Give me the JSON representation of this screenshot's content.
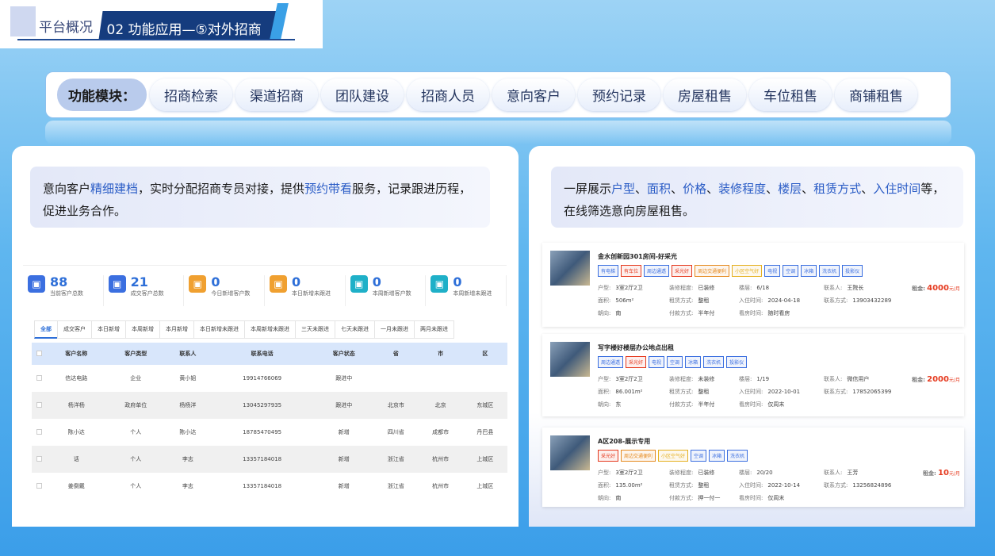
{
  "header": {
    "section": "平台概况",
    "title": "02 功能应用—⑤对外招商"
  },
  "modules": {
    "label": "功能模块：",
    "items": [
      "招商检索",
      "渠道招商",
      "团队建设",
      "招商人员",
      "意向客户",
      "预约记录",
      "房屋租售",
      "车位租售",
      "商铺租售"
    ]
  },
  "left": {
    "desc_a": "意向客户",
    "desc_b": "精细建档",
    "desc_c": "，实时分配招商专员对接，提供",
    "desc_d": "预约带看",
    "desc_e": "服务，记录跟进历程，促进业务合作。",
    "stats": [
      {
        "num": "88",
        "label": "当前客户总数",
        "color": "#3b6fe0"
      },
      {
        "num": "21",
        "label": "成交客户总数",
        "color": "#3b6fe0"
      },
      {
        "num": "0",
        "label": "今日新增客户数",
        "color": "#f0a030"
      },
      {
        "num": "0",
        "label": "本日新增未跟进",
        "color": "#f0a030"
      },
      {
        "num": "0",
        "label": "本周新增客户数",
        "color": "#1fb0c8"
      },
      {
        "num": "0",
        "label": "本周新增未跟进",
        "color": "#1fb0c8"
      }
    ],
    "tabs": [
      "全部",
      "成交客户",
      "本日新增",
      "本周新增",
      "本月新增",
      "本日新增未跟进",
      "本周新增未跟进",
      "三天未跟进",
      "七天未跟进",
      "一月未跟进",
      "两月未跟进"
    ],
    "columns": [
      "客户名称",
      "客户类型",
      "联系人",
      "联系电话",
      "客户状态",
      "省",
      "市",
      "区"
    ],
    "rows": [
      [
        "信达电路",
        "企业",
        "黄小姐",
        "19914766069",
        "跟进中",
        "",
        "",
        ""
      ],
      [
        "杨洋杨",
        "政府单位",
        "杨杨洋",
        "13045297935",
        "跟进中",
        "北京市",
        "北京",
        "东城区"
      ],
      [
        "陈小达",
        "个人",
        "陈小达",
        "18785470495",
        "新增",
        "四川省",
        "成都市",
        "丹巴县"
      ],
      [
        "话",
        "个人",
        "李志",
        "13357184018",
        "新增",
        "浙江省",
        "杭州市",
        "上城区"
      ],
      [
        "姜倒戴",
        "个人",
        "李志",
        "13357184018",
        "新增",
        "浙江省",
        "杭州市",
        "上城区"
      ]
    ]
  },
  "right": {
    "desc_a": "一屏展示",
    "desc_b": "户型",
    "desc_c": "、",
    "desc_d": "面积",
    "desc_e": "、",
    "desc_f": "价格",
    "desc_g": "、",
    "desc_h": "装修程度",
    "desc_i": "、",
    "desc_j": "楼层",
    "desc_k": "、",
    "desc_l": "租赁方式",
    "desc_m": "、",
    "desc_n": "入住时间",
    "desc_o": "等，在线筛选意向房屋租售。",
    "labels": {
      "type": "户型:",
      "area": "面积:",
      "dir": "朝向:",
      "deco": "装修程度:",
      "lease": "租赁方式:",
      "pay": "付款方式:",
      "floor": "楼层:",
      "move": "入住时间:",
      "view": "看房时间:",
      "contact": "联系人:",
      "phone": "联系方式:",
      "rent": "租金:",
      "unit": "元/月"
    },
    "cards": [
      {
        "title": "金水创新园301房间-好采光",
        "tags": [
          "有电梯",
          "有车位",
          "周边通透",
          "采光好",
          "周边交通便利",
          "小区空气好",
          "电视",
          "空调",
          "冰箱",
          "洗衣机",
          "投影仪"
        ],
        "type": "3室2厅2卫",
        "area": "506m²",
        "dir": "南",
        "deco": "已装修",
        "lease": "整租",
        "pay": "半年付",
        "floor": "6/18",
        "move": "2024-04-18",
        "view": "随时看房",
        "contact": "王院长",
        "phone": "13903432289",
        "rent": "4000"
      },
      {
        "title": "写字楼好楼层办公地点出租",
        "tags": [
          "周边通透",
          "采光好",
          "电视",
          "空调",
          "冰箱",
          "洗衣机",
          "投影仪"
        ],
        "type": "3室2厅2卫",
        "area": "86.001m²",
        "dir": "东",
        "deco": "未装修",
        "lease": "整租",
        "pay": "半年付",
        "floor": "1/19",
        "move": "2022-10-01",
        "view": "仅周末",
        "contact": "微信用户",
        "phone": "17852065399",
        "rent": "2000"
      },
      {
        "title": "A区208-展示专用",
        "tags": [
          "采光好",
          "周边交通便利",
          "小区空气好",
          "空调",
          "冰箱",
          "洗衣机"
        ],
        "type": "3室2厅2卫",
        "area": "135.00m²",
        "dir": "南",
        "deco": "已装修",
        "lease": "整租",
        "pay": "押一付一",
        "floor": "20/20",
        "move": "2022-10-14",
        "view": "仅周末",
        "contact": "王芳",
        "phone": "13256824896",
        "rent": "10"
      }
    ]
  }
}
